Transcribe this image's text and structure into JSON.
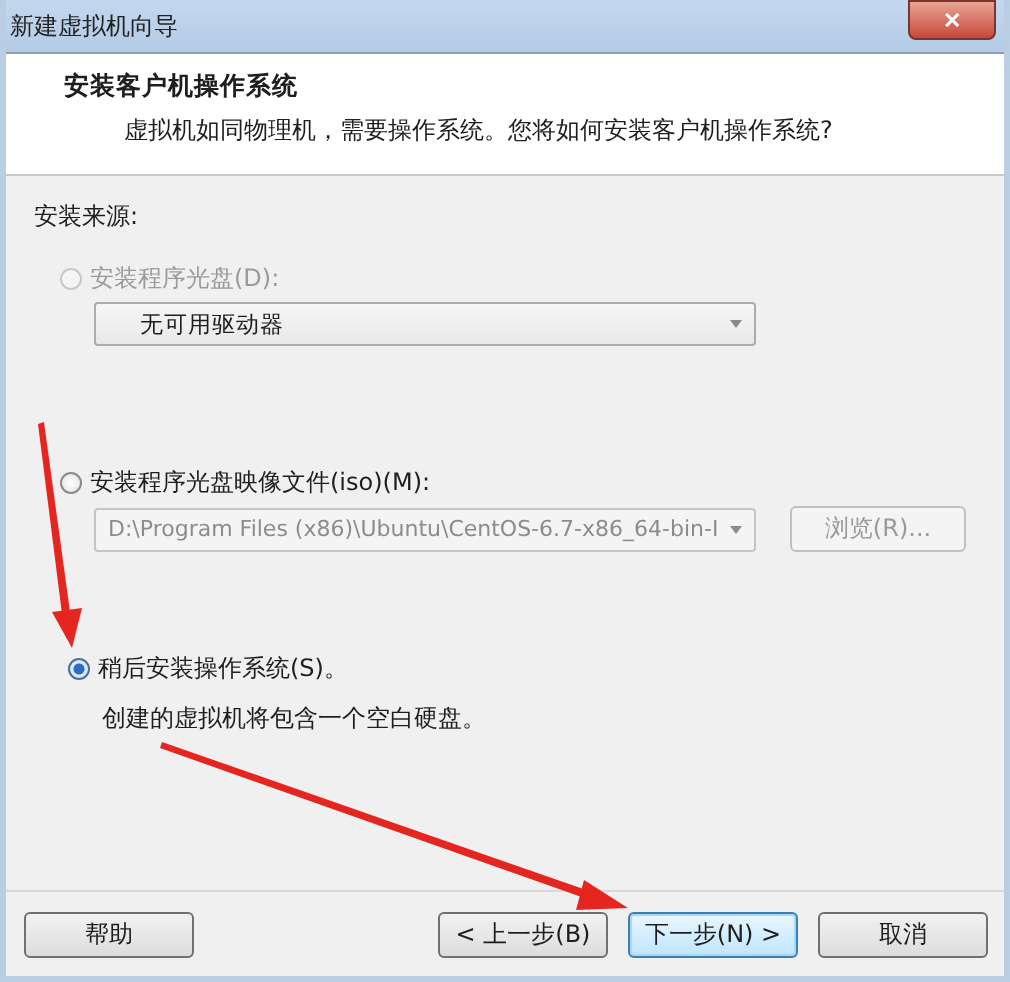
{
  "window": {
    "title": "新建虚拟机向导",
    "close": "✕"
  },
  "header": {
    "title": "安装客户机操作系统",
    "subtitle": "虚拟机如同物理机，需要操作系统。您将如何安装客户机操作系统?"
  },
  "source_label": "安装来源:",
  "options": [
    {
      "kind": "dropdown",
      "label": "安装程序光盘(D):",
      "selected": false,
      "disabled": true,
      "value": "无可用驱动器",
      "field_disabled": false
    },
    {
      "kind": "file",
      "label": "安装程序光盘映像文件(iso)(M):",
      "selected": false,
      "disabled": false,
      "value": "D:\\Program Files (x86)\\Ubuntu\\CentOS-6.7-x86_64-bin-I",
      "field_disabled": true,
      "browse": {
        "label": "浏览(R)...",
        "disabled": true
      }
    },
    {
      "kind": "note",
      "label": "稍后安装操作系统(S)。",
      "selected": true,
      "disabled": false,
      "note": "创建的虚拟机将包含一个空白硬盘。"
    }
  ],
  "buttons": [
    {
      "label": "帮助",
      "disabled": false,
      "default": false
    },
    {
      "label": "< 上一步(B)",
      "disabled": false,
      "default": false
    },
    {
      "label": "下一步(N) >",
      "disabled": false,
      "default": true
    },
    {
      "label": "取消",
      "disabled": false,
      "default": false
    }
  ]
}
